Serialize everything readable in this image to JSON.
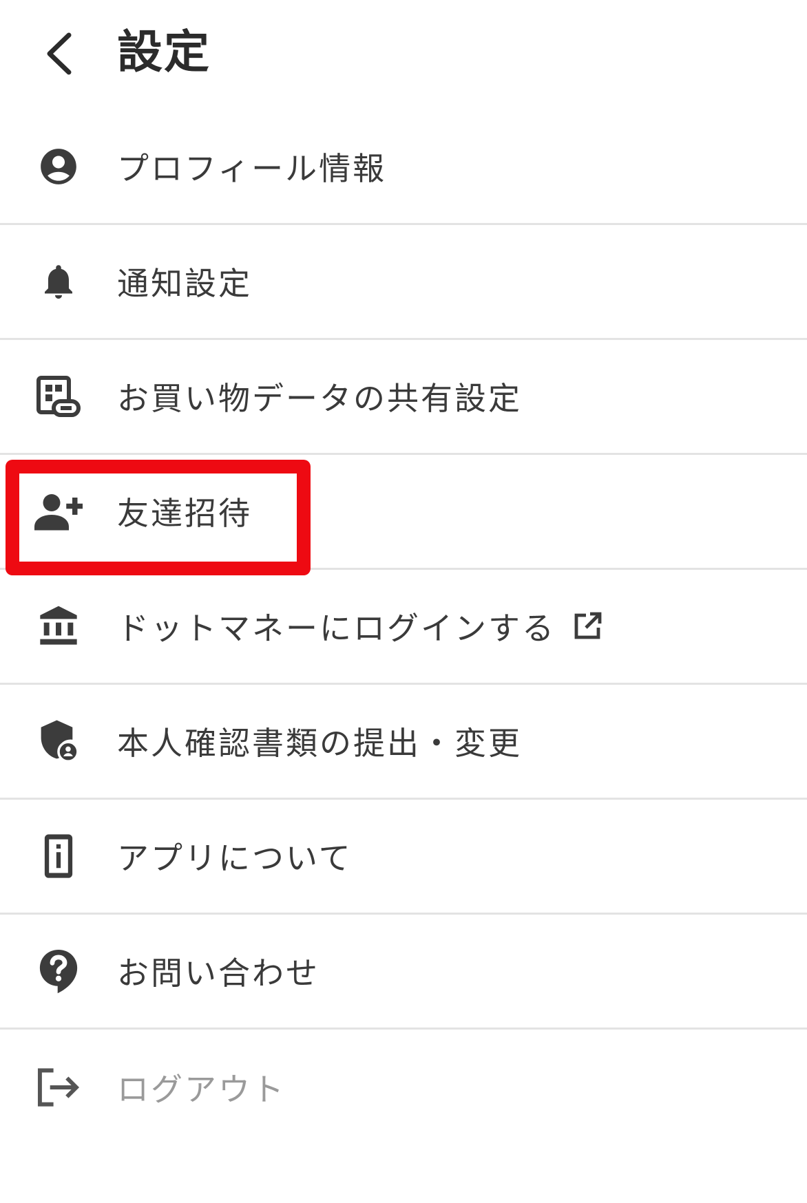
{
  "header": {
    "title": "設定",
    "back_icon": "chevron-left-icon"
  },
  "menu": {
    "items": [
      {
        "label": "プロフィール情報",
        "icon": "account-circle-icon"
      },
      {
        "label": "通知設定",
        "icon": "bell-icon"
      },
      {
        "label": "お買い物データの共有設定",
        "icon": "shopping-data-link-icon"
      },
      {
        "label": "友達招待",
        "icon": "person-add-icon"
      },
      {
        "label": "ドットマネーにログインする",
        "icon": "bank-icon",
        "trailing_icon": "open-external-icon"
      },
      {
        "label": "本人確認書類の提出・変更",
        "icon": "shield-person-icon"
      },
      {
        "label": "アプリについて",
        "icon": "info-device-icon"
      },
      {
        "label": "お問い合わせ",
        "icon": "help-bubble-icon"
      },
      {
        "label": "ログアウト",
        "icon": "logout-icon"
      }
    ]
  },
  "annotation": {
    "highlighted_item": "友達招待",
    "color": "#ee0a12"
  },
  "colors": {
    "icon": "#3c3c3c",
    "text": "#3a3a3a",
    "muted_text": "#9a9a9a",
    "divider": "#e3e3e3"
  }
}
